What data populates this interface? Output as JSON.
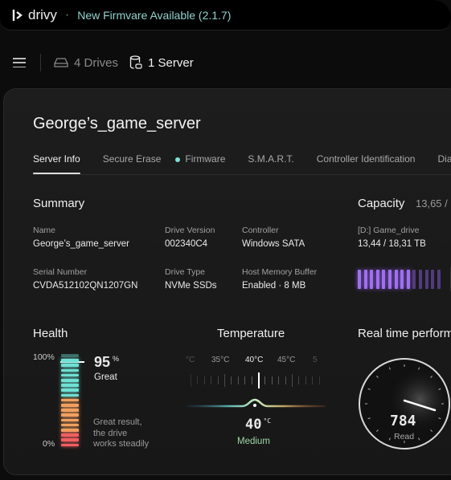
{
  "topbar": {
    "brand": "drivy",
    "separator": "·",
    "notice": "New Firmvare Available (2.1.7)"
  },
  "nav": {
    "drives": "4 Drives",
    "servers": "1 Server"
  },
  "server": {
    "title": "George’s_game_server",
    "tabs": [
      "Server Info",
      "Secure Erase",
      "Firmware",
      "S.M.A.R.T.",
      "Controller Identification",
      "Diag"
    ],
    "active_tab": "Server Info"
  },
  "summary": {
    "heading": "Summary",
    "fields": [
      {
        "label": "Name",
        "value": "George’s_game_server"
      },
      {
        "label": "Drive Version",
        "value": "002340C4"
      },
      {
        "label": "Controller",
        "value": "Windows SATA"
      },
      {
        "label": "Serial Number",
        "value": "CVDA512102QN1207GN"
      },
      {
        "label": "Drive Type",
        "value": "NVMe SSDs"
      },
      {
        "label": "Host Memory Buffer",
        "value": "Enabled  ·  8 MB"
      }
    ]
  },
  "capacity": {
    "heading": "Capacity",
    "total": "13,65 /",
    "drive_name": "[D:] Game_drive",
    "drive_usage": "13,44 / 18,31 TB",
    "used_fraction": 0.73,
    "bar_color": "#a070f0"
  },
  "health": {
    "heading": "Health",
    "max_label": "100%",
    "min_label": "0%",
    "value": "95",
    "unit": "%",
    "status": "Great",
    "description": [
      "Great result,",
      "the drive",
      "works steadily"
    ],
    "colors": {
      "good": "#6fe0d4",
      "warn": "#f0a060",
      "bad": "#f06060"
    }
  },
  "temperature": {
    "heading": "Temperature",
    "ticks": [
      "°C",
      "35°C",
      "40°C",
      "45°C",
      "5"
    ],
    "value": "40",
    "unit": "°C",
    "status": "Medium",
    "status_color": "#9fd8a8"
  },
  "performance": {
    "heading": "Real time perform",
    "value": "784",
    "label": "Read"
  }
}
